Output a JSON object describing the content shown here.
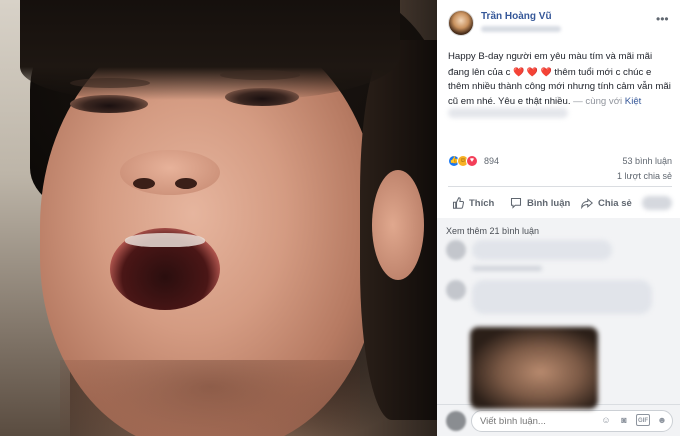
{
  "post": {
    "author": "Trần Hoàng Vũ",
    "caption_part1": "Happy B-day người em yêu màu tím và mãi mãi đang lên của c",
    "caption_hearts": "❤️ ❤️ ❤️",
    "caption_part2": "thêm tuổi mới c chúc e thêm nhiều thành công mới nhưng tính cảm vẫn mãi cũ em nhé. Yêu e thật nhiều.",
    "tag_prefix": "— cùng với",
    "tag_name": "Kiệt",
    "more_icon": "•••"
  },
  "stats": {
    "reaction_count": "894",
    "comment_count": "53 bình luận",
    "share_count": "1 lượt chia sẻ"
  },
  "actions": {
    "like_label": "Thích",
    "comment_label": "Bình luận",
    "share_label": "Chia sẻ"
  },
  "comments": {
    "view_more": "Xem thêm 21 bình luận"
  },
  "compose": {
    "placeholder": "Viết bình luận..."
  },
  "colors": {
    "link": "#365899",
    "like_blue": "#1877f2",
    "love_red": "#f33e58",
    "haha_yellow": "#f7b125"
  }
}
